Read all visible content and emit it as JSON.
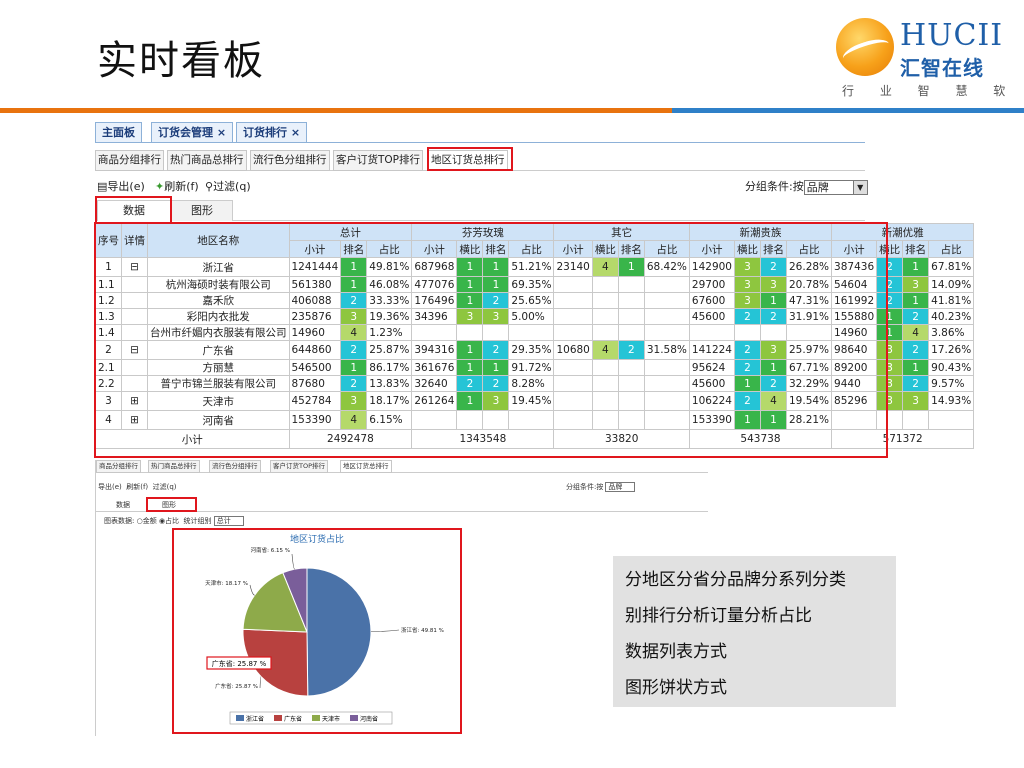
{
  "slide": {
    "title": "实时看板"
  },
  "logo": {
    "en": "HUCII",
    "cn": "汇智在线",
    "tagline": "行 业 智 慧 软 件"
  },
  "tabs": [
    "主面板",
    "订货会管理 ×",
    "订货排行 ×"
  ],
  "subtabs": [
    "商品分组排行",
    "热门商品总排行",
    "流行色分组排行",
    "客户订货TOP排行",
    "地区订货总排行"
  ],
  "toolbar": {
    "export": "导出(e)",
    "refresh": "刷新(f)",
    "filter": "过滤(q)",
    "group_label": "分组条件:按",
    "group_value": "品牌"
  },
  "views": {
    "data": "数据",
    "chart": "图形"
  },
  "table": {
    "headers": {
      "no": "序号",
      "detail": "详情",
      "region": "地区名称",
      "total": "总计",
      "brand1": "芬芳玫瑰",
      "brand2": "其它",
      "brand3": "新潮贵族",
      "brand4": "新潮优雅",
      "sub": [
        "小计",
        "排名",
        "占比"
      ],
      "sub2": [
        "小计",
        "横比",
        "排名",
        "占比"
      ]
    },
    "rows": [
      [
        "1",
        "⊟",
        "浙江省",
        "1241444",
        "1",
        "49.81%",
        "687968",
        "1",
        "1",
        "51.21%",
        "23140",
        "4",
        "1",
        "68.42%",
        "142900",
        "3",
        "2",
        "26.28%",
        "387436",
        "2",
        "1",
        "67.81%"
      ],
      [
        "1.1",
        "",
        "杭州海硕时装有限公司",
        "561380",
        "1",
        "46.08%",
        "477076",
        "1",
        "1",
        "69.35%",
        "",
        "",
        "",
        "",
        "29700",
        "3",
        "3",
        "20.78%",
        "54604",
        "2",
        "3",
        "14.09%"
      ],
      [
        "1.2",
        "",
        "嘉禾欣",
        "406088",
        "2",
        "33.33%",
        "176496",
        "1",
        "2",
        "25.65%",
        "",
        "",
        "",
        "",
        "67600",
        "3",
        "1",
        "47.31%",
        "161992",
        "2",
        "1",
        "41.81%"
      ],
      [
        "1.3",
        "",
        "彩阳内衣批发",
        "235876",
        "3",
        "19.36%",
        "34396",
        "3",
        "3",
        "5.00%",
        "",
        "",
        "",
        "",
        "45600",
        "2",
        "2",
        "31.91%",
        "155880",
        "1",
        "2",
        "40.23%"
      ],
      [
        "1.4",
        "",
        "台州市纤媚内衣服装有限公司",
        "14960",
        "4",
        "1.23%",
        "",
        "",
        "",
        "",
        "",
        "",
        "",
        "",
        "",
        "",
        "",
        "",
        "14960",
        "1",
        "4",
        "3.86%"
      ],
      [
        "2",
        "⊟",
        "广东省",
        "644860",
        "2",
        "25.87%",
        "394316",
        "1",
        "2",
        "29.35%",
        "10680",
        "4",
        "2",
        "31.58%",
        "141224",
        "2",
        "3",
        "25.97%",
        "98640",
        "3",
        "2",
        "17.26%"
      ],
      [
        "2.1",
        "",
        "方丽慧",
        "546500",
        "1",
        "86.17%",
        "361676",
        "1",
        "1",
        "91.72%",
        "",
        "",
        "",
        "",
        "95624",
        "2",
        "1",
        "67.71%",
        "89200",
        "3",
        "1",
        "90.43%"
      ],
      [
        "2.2",
        "",
        "普宁市锦兰服装有限公司",
        "87680",
        "2",
        "13.83%",
        "32640",
        "2",
        "2",
        "8.28%",
        "",
        "",
        "",
        "",
        "45600",
        "1",
        "2",
        "32.29%",
        "9440",
        "3",
        "2",
        "9.57%"
      ],
      [
        "3",
        "⊞",
        "天津市",
        "452784",
        "3",
        "18.17%",
        "261264",
        "1",
        "3",
        "19.45%",
        "",
        "",
        "",
        "",
        "106224",
        "2",
        "4",
        "19.54%",
        "85296",
        "3",
        "3",
        "14.93%"
      ],
      [
        "4",
        "⊞",
        "河南省",
        "153390",
        "4",
        "6.15%",
        "",
        "",
        "",
        "",
        "",
        "",
        "",
        "",
        "153390",
        "1",
        "1",
        "28.21%",
        "",
        "",
        "",
        ""
      ]
    ],
    "footer": {
      "label": "小计",
      "total": "2492478",
      "b1": "1343548",
      "b2": "33820",
      "b3": "543738",
      "b4": "571372"
    }
  },
  "chart_panel": {
    "radio_label": "图表数据:",
    "radio_amount": "金额",
    "radio_ratio": "占比",
    "group_label": "统计组别",
    "group_value": "总计"
  },
  "chart_data": {
    "type": "pie",
    "title": "地区订货占比",
    "categories": [
      "浙江省",
      "广东省",
      "天津市",
      "河南省"
    ],
    "values": [
      49.81,
      25.87,
      18.17,
      6.15
    ],
    "labels": [
      "浙江省: 49.81 %",
      "广东省: 25.87 %",
      "天津市: 18.17 %",
      "河南省: 6.15 %"
    ],
    "highlight_label": "广东省: 25.87 %",
    "colors": [
      "#4a72a8",
      "#b8413f",
      "#8eaa4a",
      "#7a5e9a"
    ],
    "legend": "bottom"
  },
  "note": [
    "分地区分省分品牌分系列分类",
    "别排行分析订量分析占比",
    "数据列表方式",
    "图形饼状方式"
  ]
}
